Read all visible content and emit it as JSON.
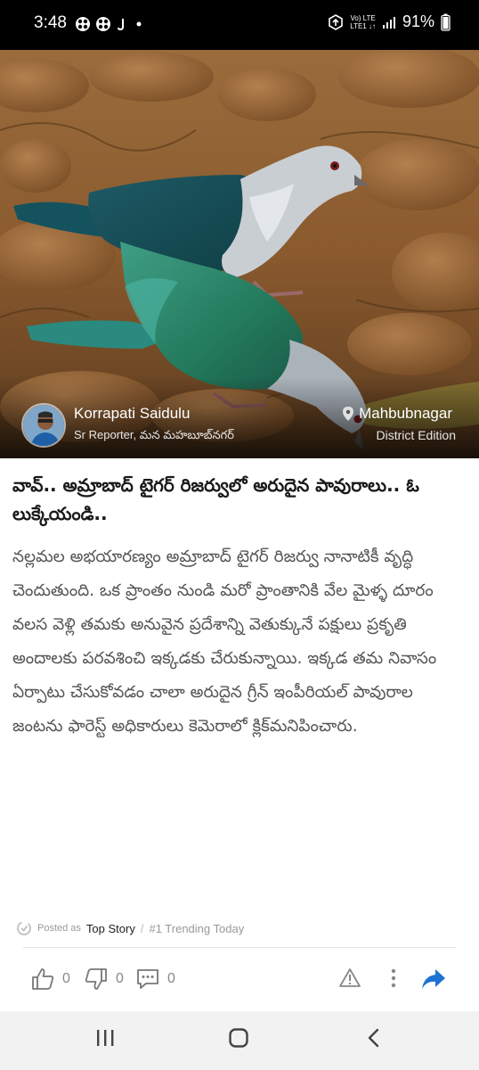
{
  "status_bar": {
    "time": "3:48",
    "battery": "91%",
    "network_line1": "Vo) LTE",
    "network_line2": "LTE1 ↓↑"
  },
  "author": {
    "name": "Korrapati Saidulu",
    "role": "Sr Reporter, మన మహబూబ్‌నగర్"
  },
  "location": {
    "name": "Mahbubnagar",
    "edition": "District Edition"
  },
  "article": {
    "headline": "వావ్.. అమ్రాబాద్ టైగర్ రిజర్వులో అరుదైన పావురాలు.. ఓ లుక్కేయండి..",
    "body": "నల్లమల అభయారణ్యం అమ్రాబాద్ టైగర్ రిజర్వు నానాటికీ వృద్ధి  చెందుతుంది. ఒక ప్రాంతం నుండి మరో ప్రాంతానికి వేల మైళ్ళ దూరం వలస  వెళ్లి తమకు అనువైన ప్రదేశాన్ని వెతుక్కునే పక్షులు ప్రకృతి అందాలకు పరవశించి ఇక్కడకు చేరుకున్నాయి. ఇక్కడ తమ నివాసం ఏర్పాటు చేసుకోవడం  చాలా అరుదైన గ్రీన్ ఇంపీరియల్ పావురాల జంటను ఫారెస్ట్ అధికారులు కెమెరాలో క్లిక్‌మనిపించారు."
  },
  "posted": {
    "label": "Posted as",
    "tag": "Top Story",
    "separator": "/",
    "trending": "#1 Trending Today"
  },
  "actions": {
    "likes": "0",
    "dislikes": "0",
    "comments": "0"
  },
  "colors": {
    "accent_share": "#1e73d2",
    "status_bar_bg": "#000000",
    "nav_bar_bg": "#f2f2f2"
  },
  "icons": {
    "status": [
      "notification-icon",
      "notification-icon",
      "notification-icon",
      "dot-icon",
      "data-saver-icon",
      "signal-icon"
    ],
    "location": "location-pin-icon",
    "actions": [
      "thumbs-up-icon",
      "thumbs-down-icon",
      "comment-icon",
      "warning-icon",
      "more-vertical-icon",
      "share-icon"
    ],
    "nav": [
      "recents-icon",
      "home-icon",
      "back-icon"
    ]
  }
}
